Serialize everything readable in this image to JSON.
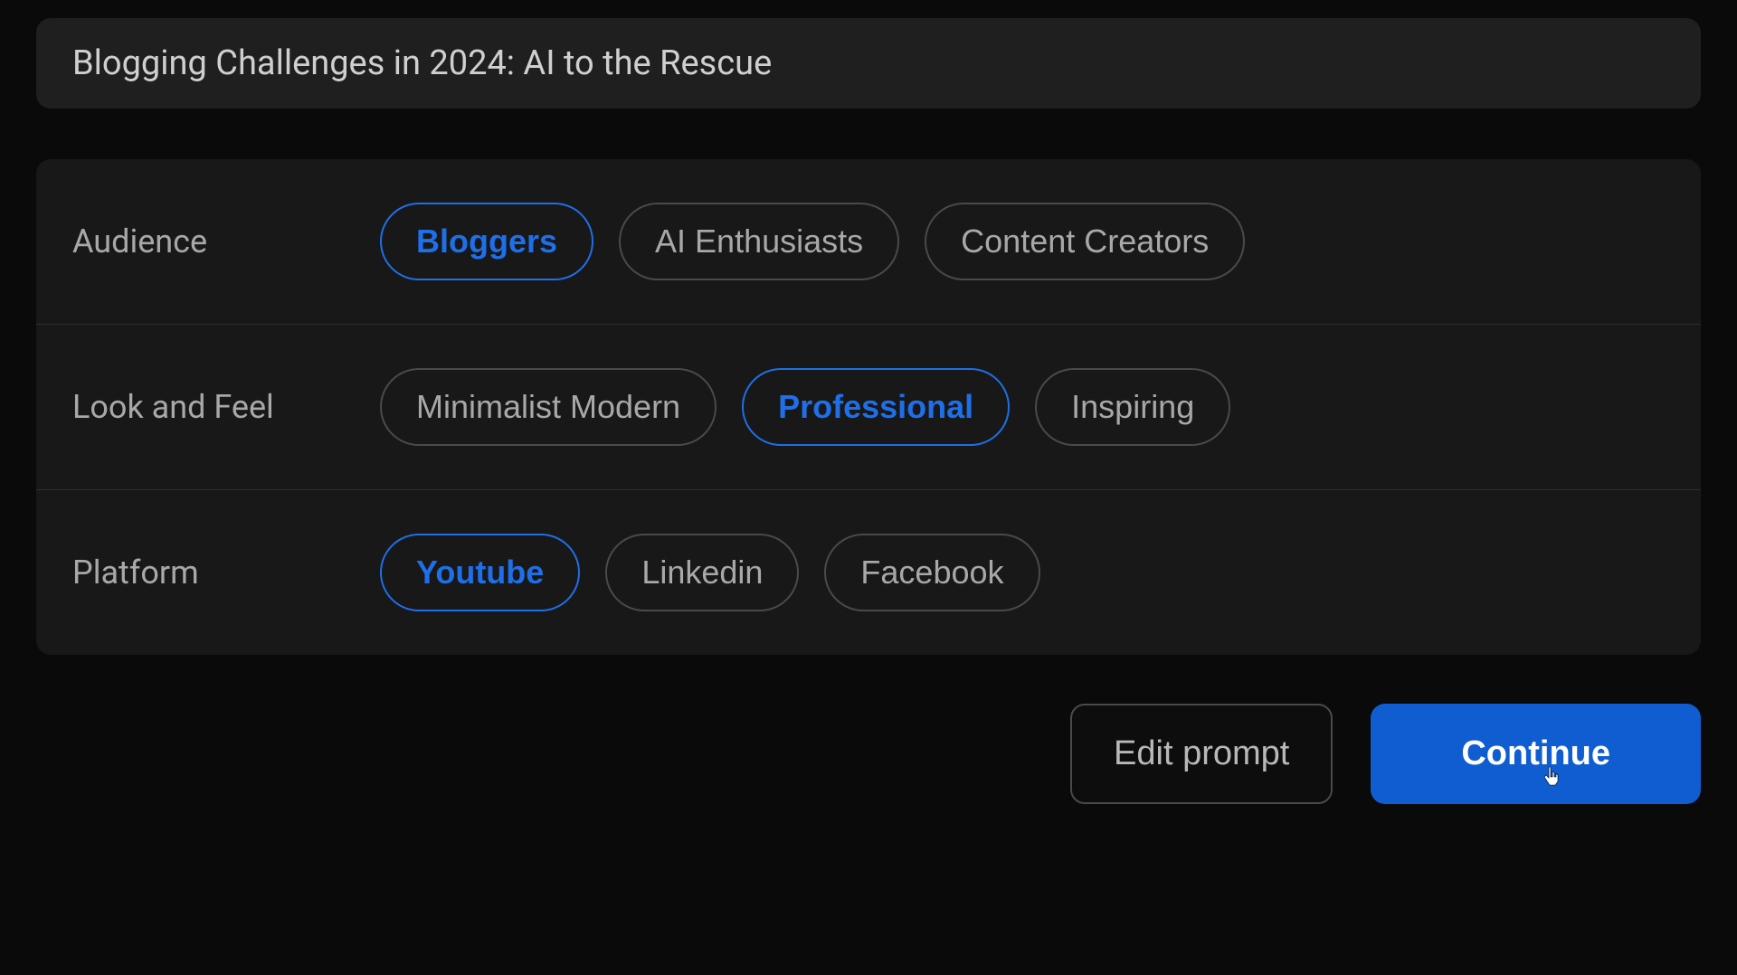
{
  "title": "Blogging Challenges in 2024: AI to the Rescue",
  "rows": {
    "audience": {
      "label": "Audience",
      "options": [
        "Bloggers",
        "AI Enthusiasts",
        "Content Creators"
      ],
      "selected": 0
    },
    "lookfeel": {
      "label": "Look and Feel",
      "options": [
        "Minimalist Modern",
        "Professional",
        "Inspiring"
      ],
      "selected": 1
    },
    "platform": {
      "label": "Platform",
      "options": [
        "Youtube",
        "Linkedin",
        "Facebook"
      ],
      "selected": 0
    }
  },
  "actions": {
    "edit": "Edit prompt",
    "continue": "Continue"
  }
}
